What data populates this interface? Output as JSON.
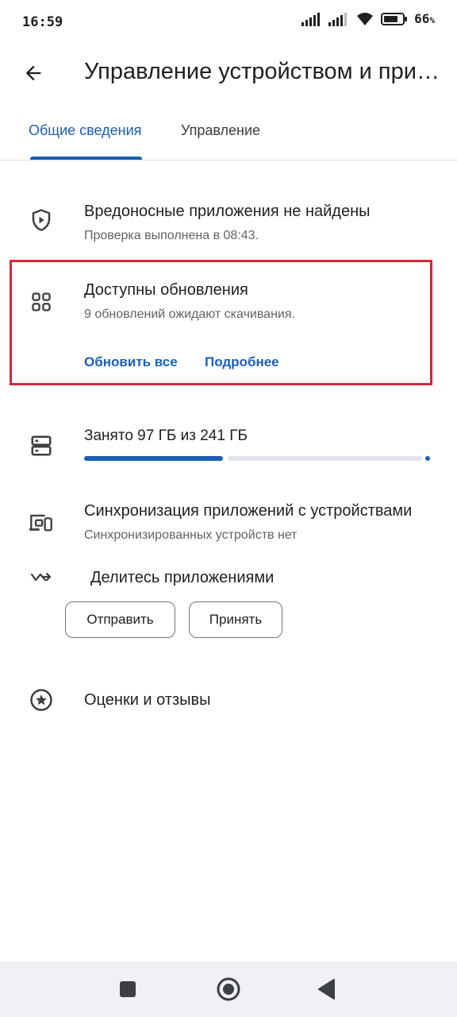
{
  "status_bar": {
    "time": "16:59",
    "battery": "66",
    "battery_unit": "%"
  },
  "header": {
    "title": "Управление устройством и прило…",
    "back_icon": "arrow-left-icon"
  },
  "tabs": [
    {
      "label": "Общие сведения",
      "active": true
    },
    {
      "label": "Управление",
      "active": false
    }
  ],
  "malware": {
    "icon": "shield-play-icon",
    "title": "Вредоносные приложения не найдены",
    "subtitle": "Проверка выполнена в 08:43."
  },
  "updates": {
    "icon": "grid-apps-icon",
    "title": "Доступны обновления",
    "subtitle": "9 обновлений ожидают скачивания.",
    "update_all_label": "Обновить все",
    "details_label": "Подробнее",
    "highlight_color": "#d1283a"
  },
  "storage": {
    "icon": "storage-icon",
    "title": "Занято 97 ГБ из 241 ГБ",
    "used_gb": 97,
    "total_gb": 241,
    "used_color": "#1a5fb4"
  },
  "sync": {
    "icon": "devices-icon",
    "title": "Синхронизация приложений с устройствами",
    "subtitle": "Синхронизированных устройств нет"
  },
  "share": {
    "icon": "share-apps-icon",
    "title": "Делитесь приложениями",
    "send_label": "Отправить",
    "receive_label": "Принять"
  },
  "ratings": {
    "icon": "star-circle-icon",
    "title": "Оценки и отзывы"
  },
  "navbar": {
    "recents_icon": "square-icon",
    "home_icon": "circle-home-icon",
    "back_icon": "triangle-back-icon"
  },
  "colors": {
    "accent": "#1a5fb4",
    "text": "#1f1f1f",
    "subtext": "#5f6368"
  }
}
